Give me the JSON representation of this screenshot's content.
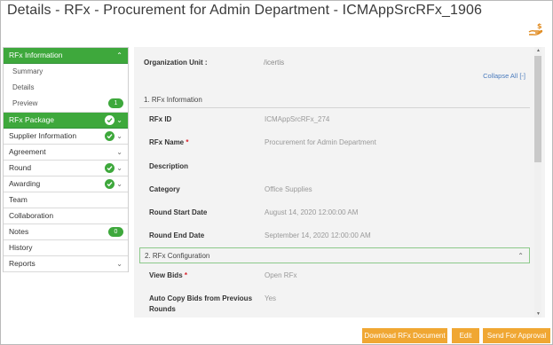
{
  "page": {
    "title": "Details - RFx - Procurement for Admin Department - ICMAppSrcRFx_1906"
  },
  "header": {
    "icon": "hand-coin-icon"
  },
  "sidebar": {
    "items": [
      {
        "label": "RFx Information",
        "active": true
      },
      {
        "label": "Summary"
      },
      {
        "label": "Details"
      },
      {
        "label": "Preview",
        "badge": "1"
      },
      {
        "label": "RFx Package",
        "active": true
      },
      {
        "label": "Supplier Information"
      },
      {
        "label": "Agreement"
      },
      {
        "label": "Round"
      },
      {
        "label": "Awarding"
      },
      {
        "label": "Team"
      },
      {
        "label": "Collaboration"
      },
      {
        "label": "Notes",
        "badge": "0"
      },
      {
        "label": "History"
      },
      {
        "label": "Reports"
      }
    ]
  },
  "main": {
    "org_label": "Organization Unit :",
    "org_value": "/icertis",
    "collapse_all": "Collapse All [-]",
    "section1": {
      "title": "1. RFx Information",
      "fields": [
        {
          "label": "RFx ID",
          "value": "ICMAppSrcRFx_274"
        },
        {
          "label": "RFx Name",
          "required": "*",
          "value": "Procurement for Admin Department"
        },
        {
          "label": "Description",
          "value": ""
        },
        {
          "label": "Category",
          "value": "Office Supplies"
        },
        {
          "label": "Round Start Date",
          "value": "August 14, 2020 12:00:00 AM"
        },
        {
          "label": "Round End Date",
          "value": "September 14, 2020 12:00:00 AM"
        }
      ]
    },
    "section2": {
      "title": "2. RFx Configuration",
      "fields": [
        {
          "label": "View Bids",
          "required": "*",
          "value": "Open RFx"
        },
        {
          "label": "Auto Copy Bids from Previous",
          "label2": "Rounds",
          "value": "Yes"
        }
      ]
    }
  },
  "footer": {
    "download": "Download RFx Document",
    "edit": "Edit",
    "send": "Send For Approval"
  },
  "colors": {
    "accent_green": "#3ea83c",
    "button_orange": "#f0a733",
    "link_blue": "#4a7bbd"
  }
}
